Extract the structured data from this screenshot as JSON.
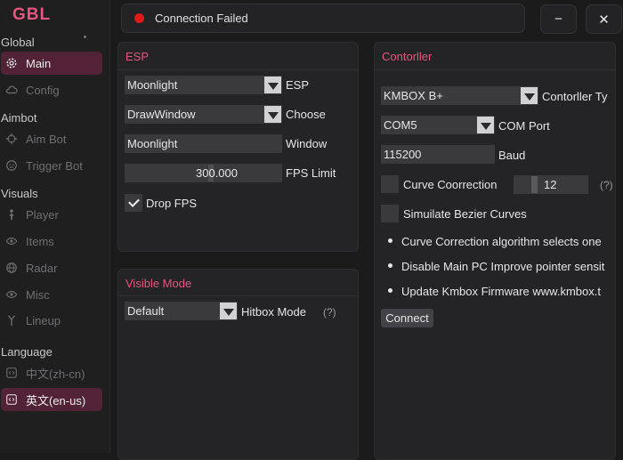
{
  "app": {
    "logo": "GBL"
  },
  "status": {
    "text": "Connection Failed",
    "color": "#e01919"
  },
  "window": {
    "minimize_icon": "minus-icon",
    "close_icon": "close-icon",
    "minimize_label": "−",
    "close_label": "✕"
  },
  "sidebar": {
    "global_title": "Global",
    "aimbot_title": "Aimbot",
    "visuals_title": "Visuals",
    "language_title": "Language",
    "items": {
      "main": {
        "label": "Main",
        "icon": "gear-icon"
      },
      "config": {
        "label": "Config",
        "icon": "cloud-icon"
      },
      "aim_bot": {
        "label": "Aim Bot",
        "icon": "crosshair-icon"
      },
      "trigger_bot": {
        "label": "Trigger Bot",
        "icon": "face-icon"
      },
      "player": {
        "label": "Player",
        "icon": "person-icon"
      },
      "items": {
        "label": "Items",
        "icon": "eye-icon"
      },
      "radar": {
        "label": "Radar",
        "icon": "globe-icon"
      },
      "misc": {
        "label": "Misc",
        "icon": "eye-icon"
      },
      "lineup": {
        "label": "Lineup",
        "icon": "pin-icon"
      },
      "lang_zh": {
        "label": "中文(zh-cn)",
        "icon": "code-icon"
      },
      "lang_en": {
        "label": "英文(en-us)",
        "icon": "code-icon"
      }
    },
    "active_color": "#522236"
  },
  "esp": {
    "title": "ESP",
    "esp_select_value": "Moonlight",
    "esp_label": "ESP",
    "choose_select_value": "DrawWindow",
    "choose_label": "Choose",
    "window_input_value": "Moonlight",
    "window_label": "Window",
    "fps_value": "300.000",
    "fps_label": "FPS Limit",
    "drop_fps_label": "Drop FPS",
    "drop_fps_checked": true
  },
  "visible_mode": {
    "title": "Visible Mode",
    "hitbox_select_value": "Default",
    "hitbox_label": "Hitbox Mode",
    "help": "(?)"
  },
  "controller": {
    "title": "Contorller",
    "type_select_value": "KMBOX B+",
    "type_label": "Contorller Ty",
    "port_select_value": "COM5",
    "port_label": "COM Port",
    "baud_value": "115200",
    "baud_label": "Baud",
    "curve_label": "Curve Coorrection",
    "curve_value": "12",
    "curve_help": "(?)",
    "bezier_label": "Simuilate Bezier Curves",
    "notes": [
      "Curve Correction algorithm selects one",
      "Disable Main PC Improve pointer sensit",
      "Update Kmbox Firmware www.kmbox.t"
    ],
    "connect_label": "Connect"
  },
  "colors": {
    "accent": "#e8547f",
    "background": "#1b1b1c",
    "panel": "#242426"
  }
}
